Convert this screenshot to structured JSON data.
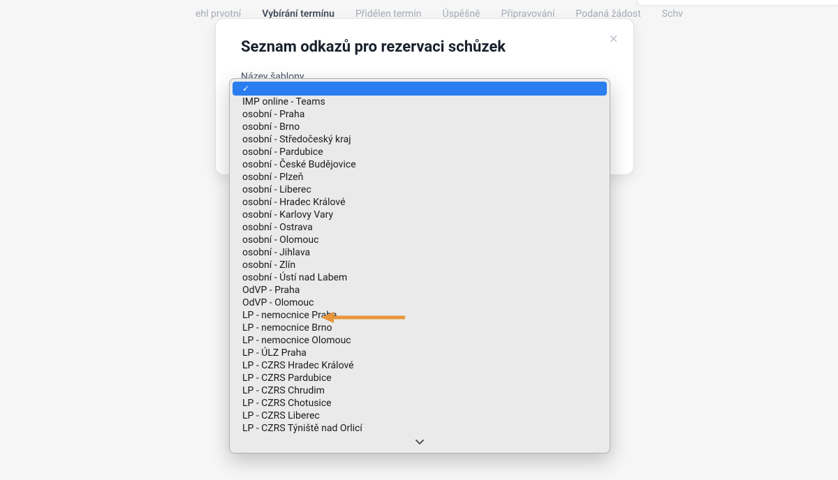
{
  "tabs": {
    "t0": "ehl prvotní",
    "t1": "Vybírání termínu",
    "t2": "Přidělen termín",
    "t3": "Úspěšně",
    "t4": "Připravování",
    "t5": "Podaná žádost",
    "t6": "Schv"
  },
  "modal": {
    "title": "Seznam odkazů pro rezervaci schůzek",
    "field_label": "Název šablony",
    "close_aria": "Close"
  },
  "dropdown": {
    "selected_value": "",
    "items": {
      "i0": "IMP online - Teams",
      "i1": "osobní - Praha",
      "i2": "osobní - Brno",
      "i3": "osobní - Středočeský kraj",
      "i4": "osobní - Pardubice",
      "i5": "osobní - České Budějovice",
      "i6": "osobní - Plzeň",
      "i7": "osobní - Liberec",
      "i8": "osobní - Hradec Králové",
      "i9": "osobní - Karlovy Vary",
      "i10": "osobní - Ostrava",
      "i11": "osobní - Olomouc",
      "i12": "osobní - Jihlava",
      "i13": "osobní - Zlín",
      "i14": "osobní - Ústí nad Labem",
      "i15": "OdVP - Praha",
      "i16": "OdVP - Olomouc",
      "i17": "LP - nemocnice Praha",
      "i18": "LP - nemocnice Brno",
      "i19": "LP - nemocnice Olomouc",
      "i20": "LP - ÚLZ Praha",
      "i21": "LP - CZRS Hradec Králové",
      "i22": "LP - CZRS Pardubice",
      "i23": "LP - CZRS Chrudim",
      "i24": "LP - CZRS Chotusice",
      "i25": "LP - CZRS Liberec",
      "i26": "LP - CZRS Týniště nad Orlicí"
    }
  },
  "arrow_target_item": "LP - nemocnice Praha"
}
